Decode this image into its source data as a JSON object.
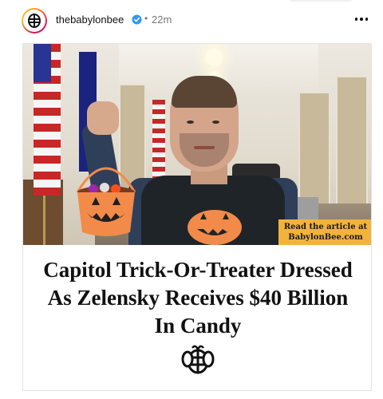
{
  "post": {
    "username": "thebabylonbee",
    "separator": "•",
    "timestamp": "22m",
    "more_icon": "more-horizontal-icon"
  },
  "card": {
    "cta": {
      "line1": "Read the article at",
      "line2": "BabylonBee.com",
      "background": "#f2b33d"
    },
    "headline": {
      "line1": "Capitol Trick-Or-Treater Dressed",
      "line2": "As Zelensky Receives $40 Billion",
      "line3": "In Candy"
    },
    "logo_icon": "babylon-bee-logo-icon"
  },
  "colors": {
    "accent_orange": "#f2b33d",
    "verified_blue": "#3897f0",
    "text": "#111111",
    "meta_gray": "#777777"
  }
}
